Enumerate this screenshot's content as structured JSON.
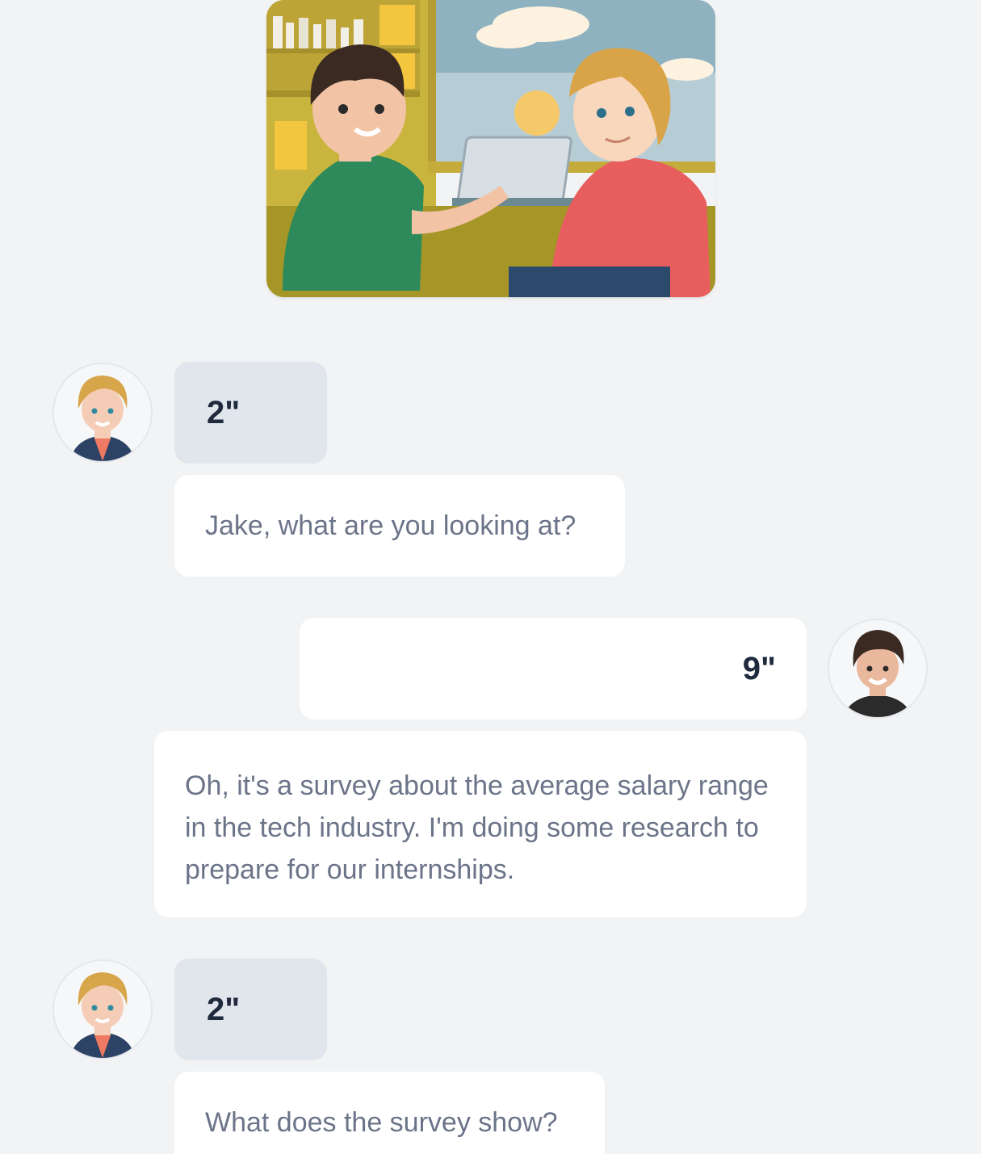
{
  "scene_image": {
    "description_icon": "two-students-talking-illustration"
  },
  "messages": [
    {
      "speaker_avatar": "blonde-student-avatar",
      "duration": "2\"",
      "text": "Jake, what are you looking at?"
    },
    {
      "speaker_avatar": "dark-haired-student-avatar",
      "duration": "9\"",
      "text": "Oh, it's a survey about the average salary range in the tech industry. I'm doing some research to prepare for our internships."
    },
    {
      "speaker_avatar": "blonde-student-avatar",
      "duration": "2\"",
      "text": "What does the survey show?"
    }
  ],
  "colors": {
    "background": "#f2f3f5",
    "duration_bubble": "#e1e5ec",
    "text_bubble": "#ffffff",
    "text": "#6b7488",
    "duration_text": "#1f2a3d"
  }
}
